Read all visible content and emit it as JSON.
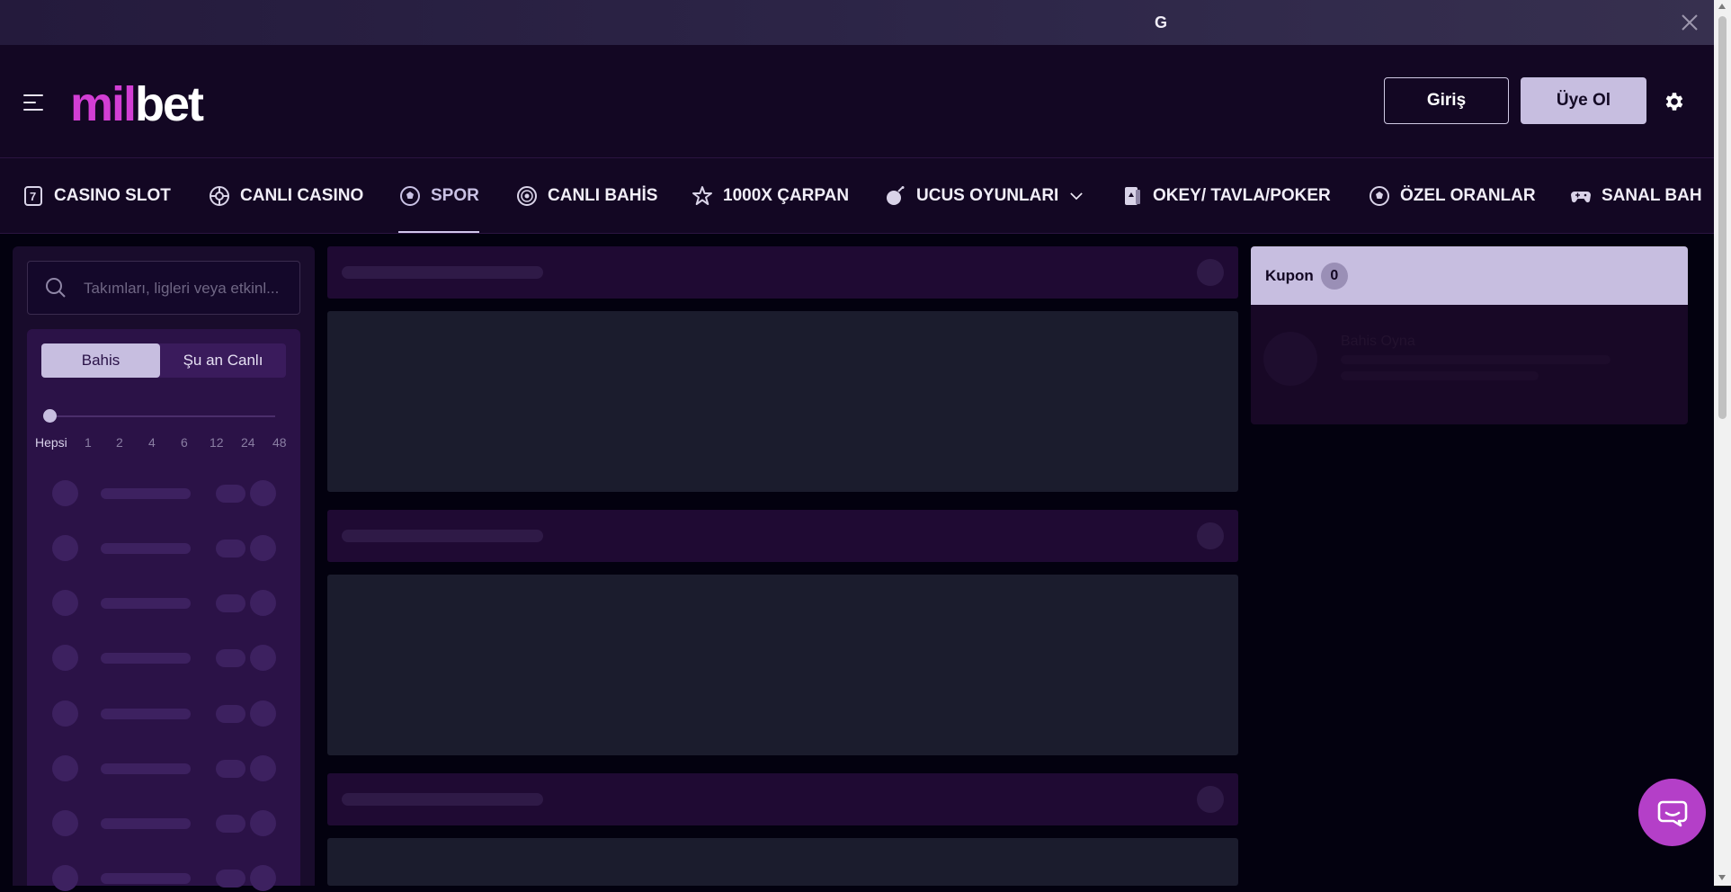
{
  "topbar": {
    "g_text": "G"
  },
  "header": {
    "logo_part1": "mil",
    "logo_part2": "bet",
    "login_label": "Giriş",
    "register_label": "Üye Ol"
  },
  "nav": {
    "items": [
      {
        "label": "CASINO SLOT",
        "icon": "slot-icon"
      },
      {
        "label": "CANLI CASINO",
        "icon": "roulette-icon"
      },
      {
        "label": "SPOR",
        "icon": "football-icon",
        "active": true
      },
      {
        "label": "CANLI BAHİS",
        "icon": "live-signal-icon"
      },
      {
        "label": "1000X ÇARPAN",
        "icon": "star-icon"
      },
      {
        "label": "UCUS OYUNLARI",
        "icon": "bomb-icon",
        "dropdown": true
      },
      {
        "label": "OKEY/ TAVLA/POKER",
        "icon": "cards-icon"
      },
      {
        "label": "ÖZEL ORANLAR",
        "icon": "football-icon"
      },
      {
        "label": "SANAL BAH",
        "icon": "gamepad-icon"
      }
    ]
  },
  "sidebar": {
    "search_placeholder": "Takımları, ligleri veya etkinl...",
    "toggle": {
      "bet": "Bahis",
      "live": "Şu an Canlı"
    },
    "time_filter": [
      "Hepsi",
      "1",
      "2",
      "4",
      "6",
      "12",
      "24",
      "48"
    ],
    "time_filter_selected": "Hepsi"
  },
  "coupon": {
    "title": "Kupon",
    "count": "0",
    "empty_title": "Bahis Oyna"
  },
  "colors": {
    "brand_pink": "#d23ed4",
    "accent_lavender": "#c7bee0",
    "header_bg": "#130723",
    "chat_bubble": "#b43fc8"
  }
}
